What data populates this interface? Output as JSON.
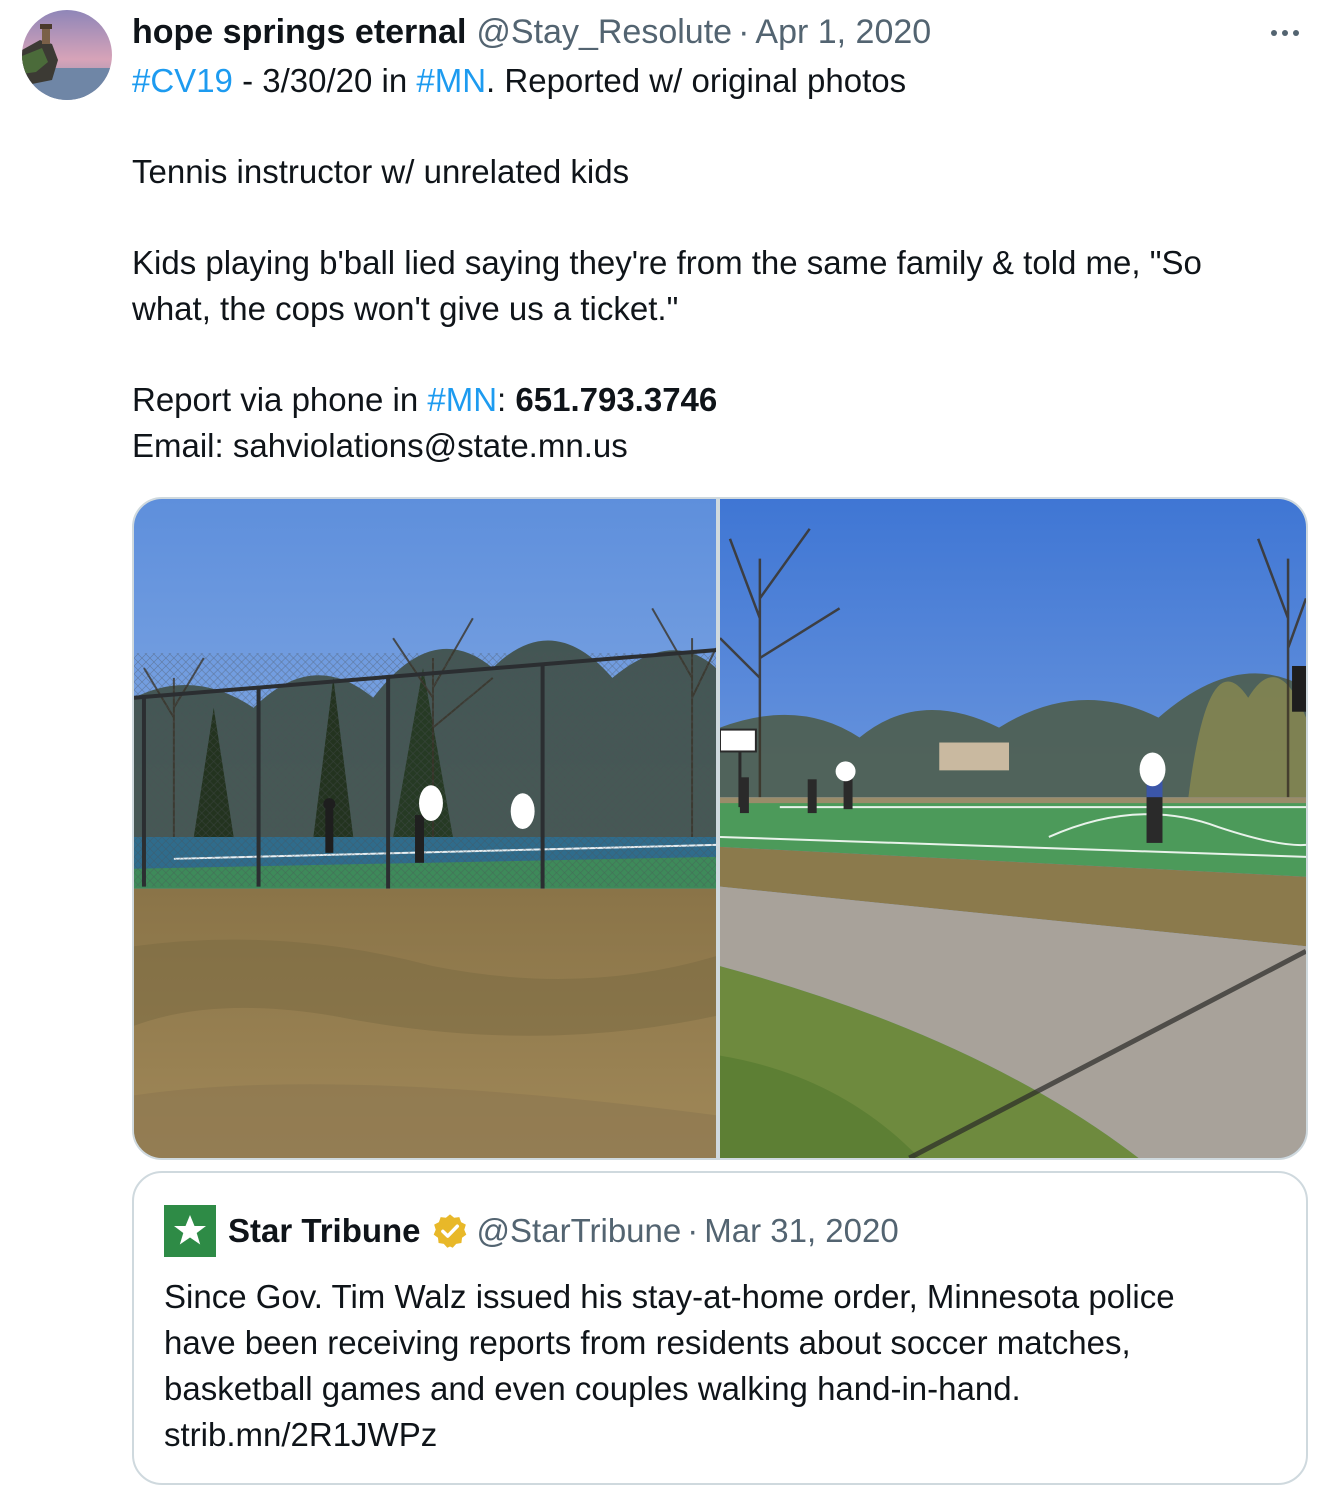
{
  "tweet": {
    "author": {
      "display_name": "hope springs eternal",
      "handle": "@Stay_Resolute",
      "separator": "·",
      "date": "Apr 1, 2020",
      "avatar_icon": "lighthouse-avatar"
    },
    "more_icon": "more-dots-icon",
    "text": {
      "line1": {
        "tag1": "#CV19",
        "mid": " - 3/30/20 in ",
        "tag2": "#MN",
        "end": ". Reported w/ original photos"
      },
      "line2": "Tennis instructor w/ unrelated kids",
      "line3": "Kids playing b'ball lied saying they're from the same family & told me, \"So",
      "line4": "what, the cops won't give us a ticket.\"",
      "line5": {
        "start": "Report via phone in ",
        "tag": "#MN",
        "colon": ": ",
        "phone": "651.793.3746"
      },
      "line6": "Email: sahviolations@state.mn.us"
    },
    "media": [
      {
        "name": "tennis-court-photo"
      },
      {
        "name": "basketball-court-photo"
      }
    ],
    "quote": {
      "author": {
        "display_name": "Star Tribune",
        "handle": "@StarTribune",
        "separator": "·",
        "date": "Mar 31, 2020",
        "avatar_icon": "star-logo-icon",
        "verified_icon": "gold-verified-badge-icon"
      },
      "text": {
        "line1": "Since Gov. Tim Walz issued his stay-at-home order, Minnesota police",
        "line2": "have been receiving reports from residents about soccer matches,",
        "line3": "basketball games and even couples walking hand-in-hand.",
        "line4": "strib.mn/2R1JWPz"
      }
    }
  },
  "colors": {
    "text_primary": "#0f1419",
    "text_secondary": "#536471",
    "link": "#1d9bf0",
    "border": "#cfd9de",
    "verified_gold": "#e8b829",
    "startribune_green": "#2e8b46"
  }
}
